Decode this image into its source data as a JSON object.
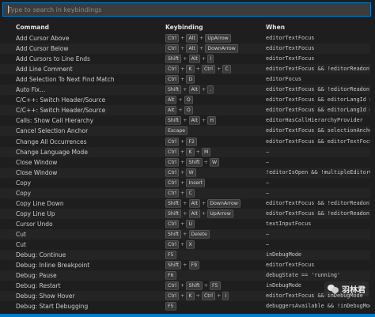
{
  "search": {
    "placeholder": "Type to search in keybindings"
  },
  "headers": {
    "command": "Command",
    "keybinding": "Keybinding",
    "when": "When"
  },
  "rows": [
    {
      "command": "Add Cursor Above",
      "keys": [
        "Ctrl",
        "Alt",
        "UpArrow"
      ],
      "when": "editorTextFocus"
    },
    {
      "command": "Add Cursor Below",
      "keys": [
        "Ctrl",
        "Alt",
        "DownArrow"
      ],
      "when": "editorTextFocus"
    },
    {
      "command": "Add Cursors to Line Ends",
      "keys": [
        "Shift",
        "Alt",
        "I"
      ],
      "when": "editorTextFocus"
    },
    {
      "command": "Add Line Comment",
      "keys": [
        "Ctrl",
        "K",
        "Ctrl",
        "C"
      ],
      "when": "editorTextFocus && !editorReadonly"
    },
    {
      "command": "Add Selection To Next Find Match",
      "keys": [
        "Ctrl",
        "D"
      ],
      "when": "editorFocus"
    },
    {
      "command": "Auto Fix...",
      "keys": [
        "Shift",
        "Alt",
        "."
      ],
      "when": "editorTextFocus && !editorReadonly && sup"
    },
    {
      "command": "C/C++: Switch Header/Source",
      "keys": [
        "Alt",
        "O"
      ],
      "when": "editorTextFocus && editorLangId == 'cpp'"
    },
    {
      "command": "C/C++: Switch Header/Source",
      "keys": [
        "Alt",
        "O"
      ],
      "when": "editorTextFocus && editorLangId == 'c'"
    },
    {
      "command": "Calls: Show Call Hierarchy",
      "keys": [
        "Shift",
        "Alt",
        "H"
      ],
      "when": "editorHasCallHierarchyProvider"
    },
    {
      "command": "Cancel Selection Anchor",
      "keys": [
        "Escape"
      ],
      "when": "editorTextFocus && selectionAnchorSet"
    },
    {
      "command": "Change All Occurrences",
      "keys": [
        "Ctrl",
        "F2"
      ],
      "when": "editorTextFocus && editorTextFocus && !e"
    },
    {
      "command": "Change Language Mode",
      "keys": [
        "Ctrl",
        "K",
        "M"
      ],
      "when": "—"
    },
    {
      "command": "Close Window",
      "keys": [
        "Ctrl",
        "Shift",
        "W"
      ],
      "when": "—"
    },
    {
      "command": "Close Window",
      "keys": [
        "Ctrl",
        "W"
      ],
      "when": "!editorIsOpen && !multipleEditorGroups"
    },
    {
      "command": "Copy",
      "keys": [
        "Ctrl",
        "Insert"
      ],
      "when": "—"
    },
    {
      "command": "Copy",
      "keys": [
        "Ctrl",
        "C"
      ],
      "when": "—"
    },
    {
      "command": "Copy Line Down",
      "keys": [
        "Shift",
        "Alt",
        "DownArrow"
      ],
      "when": "editorTextFocus && !editorReadonly"
    },
    {
      "command": "Copy Line Up",
      "keys": [
        "Shift",
        "Alt",
        "UpArrow"
      ],
      "when": "editorTextFocus && !editorReadonly"
    },
    {
      "command": "Cursor Undo",
      "keys": [
        "Ctrl",
        "U"
      ],
      "when": "textInputFocus"
    },
    {
      "command": "Cut",
      "keys": [
        "Shift",
        "Delete"
      ],
      "when": "—"
    },
    {
      "command": "Cut",
      "keys": [
        "Ctrl",
        "X"
      ],
      "when": "—"
    },
    {
      "command": "Debug: Continue",
      "keys": [
        "F5"
      ],
      "when": "inDebugMode"
    },
    {
      "command": "Debug: Inline Breakpoint",
      "keys": [
        "Shift",
        "F9"
      ],
      "when": "editorTextFocus"
    },
    {
      "command": "Debug: Pause",
      "keys": [
        "F6"
      ],
      "when": "debugState == 'running'"
    },
    {
      "command": "Debug: Restart",
      "keys": [
        "Ctrl",
        "Shift",
        "F5"
      ],
      "when": "inDebugMode"
    },
    {
      "command": "Debug: Show Hover",
      "keys": [
        "Ctrl",
        "K",
        "Ctrl",
        "I"
      ],
      "when": "editorTextFocus && inDebugMode"
    },
    {
      "command": "Debug: Start Debugging",
      "keys": [
        "F5"
      ],
      "when": "debuggersAvailable && !inDebugMode"
    }
  ],
  "watermark": {
    "text": "羽林君"
  },
  "colors": {
    "accent": "#007acc",
    "background": "#1e1e1e"
  }
}
